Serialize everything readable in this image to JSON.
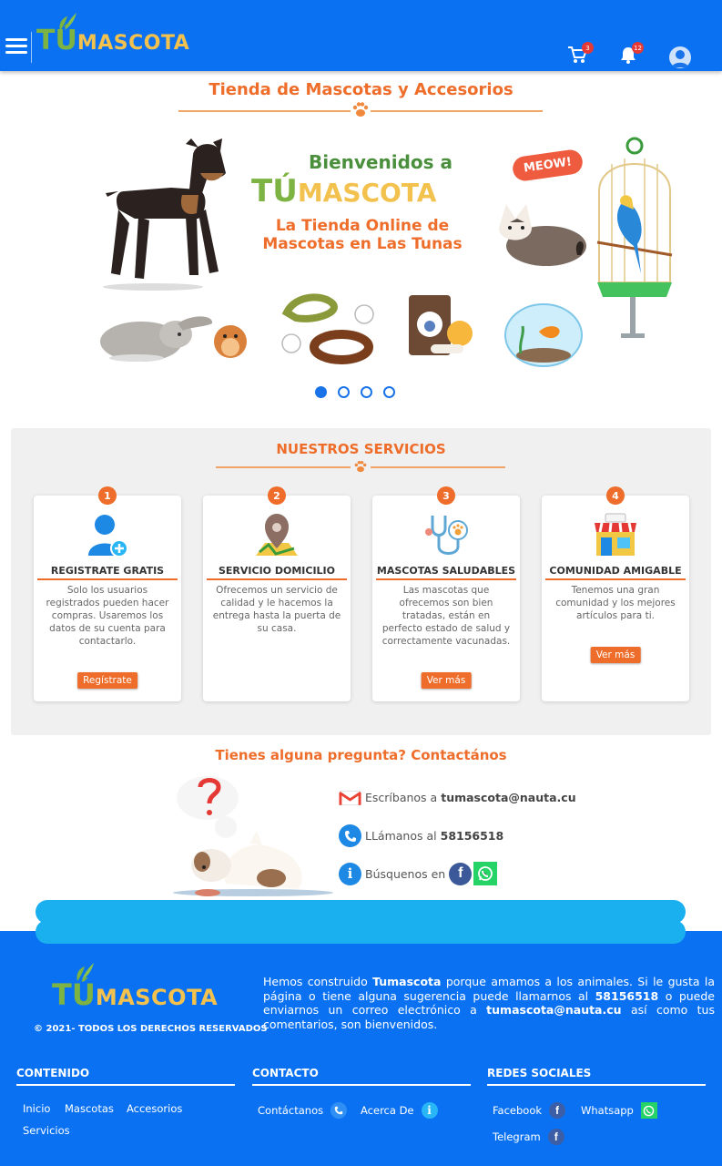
{
  "header": {
    "logo_tu": "TÚ",
    "logo_mascota": "MASCOTA",
    "cart_count": "3",
    "notifications_count": "12"
  },
  "page_title": "Tienda de Mascotas y Accesorios",
  "hero": {
    "line1": "Bienvenidos a",
    "logo_tu": "TÚ",
    "logo_mascota": "MASCOTA",
    "line2": "La Tienda Online de",
    "line3": "Mascotas en Las Tunas",
    "meow": "MEOW!",
    "slide_count": 4,
    "active_slide": 1
  },
  "services": {
    "title": "NUESTROS SERVICIOS",
    "cards": [
      {
        "num": "1",
        "title": "REGISTRATE GRATIS",
        "text": "Solo los usuarios registrados pueden hacer compras. Usaremos los datos de su cuenta para contactarlo.",
        "button": "Regístrate"
      },
      {
        "num": "2",
        "title": "SERVICIO DOMICILIO",
        "text": "Ofrecemos un servicio de calidad y le hacemos la entrega hasta la puerta de su casa.",
        "button": ""
      },
      {
        "num": "3",
        "title": "MASCOTAS SALUDABLES",
        "text": "Las mascotas que ofrecemos son bien tratadas, están en perfecto estado de salud y correctamente vacunadas.",
        "button": "Ver más"
      },
      {
        "num": "4",
        "title": "COMUNIDAD AMIGABLE",
        "text": "Tenemos una gran comunidad y los mejores artículos para ti.",
        "button": "Ver más"
      }
    ]
  },
  "contact": {
    "title": "Tienes alguna pregunta? Contactános",
    "email_label": "Escríbanos a",
    "email": "tumascota@nauta.cu",
    "phone_label": "LLámanos al",
    "phone": "58156518",
    "social_label": "Búsquenos en"
  },
  "footer": {
    "logo_tu": "TÚ",
    "logo_mascota": "MASCOTA",
    "copyright": "© 2021- TODOS LOS DERECHOS RESERVADOS",
    "about_1": "Hemos construido",
    "about_brand": "Tumascota",
    "about_2": "porque amamos a los animales. Si le gusta la página o tiene alguna sugerencia puede llamarnos al",
    "about_phone": "58156518",
    "about_3": "o puede enviarnos un correo electrónico a",
    "about_email": "tumascota@nauta.cu",
    "about_4": "así como tus comentarios, son bienvenidos.",
    "contenido_title": "CONTENIDO",
    "contenido_links": [
      "Inicio",
      "Mascotas",
      "Accesorios",
      "Servicios"
    ],
    "contacto_title": "CONTACTO",
    "contacto_links": [
      "Contáctanos",
      "Acerca De"
    ],
    "redes_title": "REDES SOCIALES",
    "redes_links": [
      "Facebook",
      "Whatsapp",
      "Telegram"
    ]
  },
  "colors": {
    "primary": "#0a72f2",
    "accent": "#ee6d2a",
    "logo_green": "#7cb342",
    "logo_yellow": "#f2c14e"
  }
}
